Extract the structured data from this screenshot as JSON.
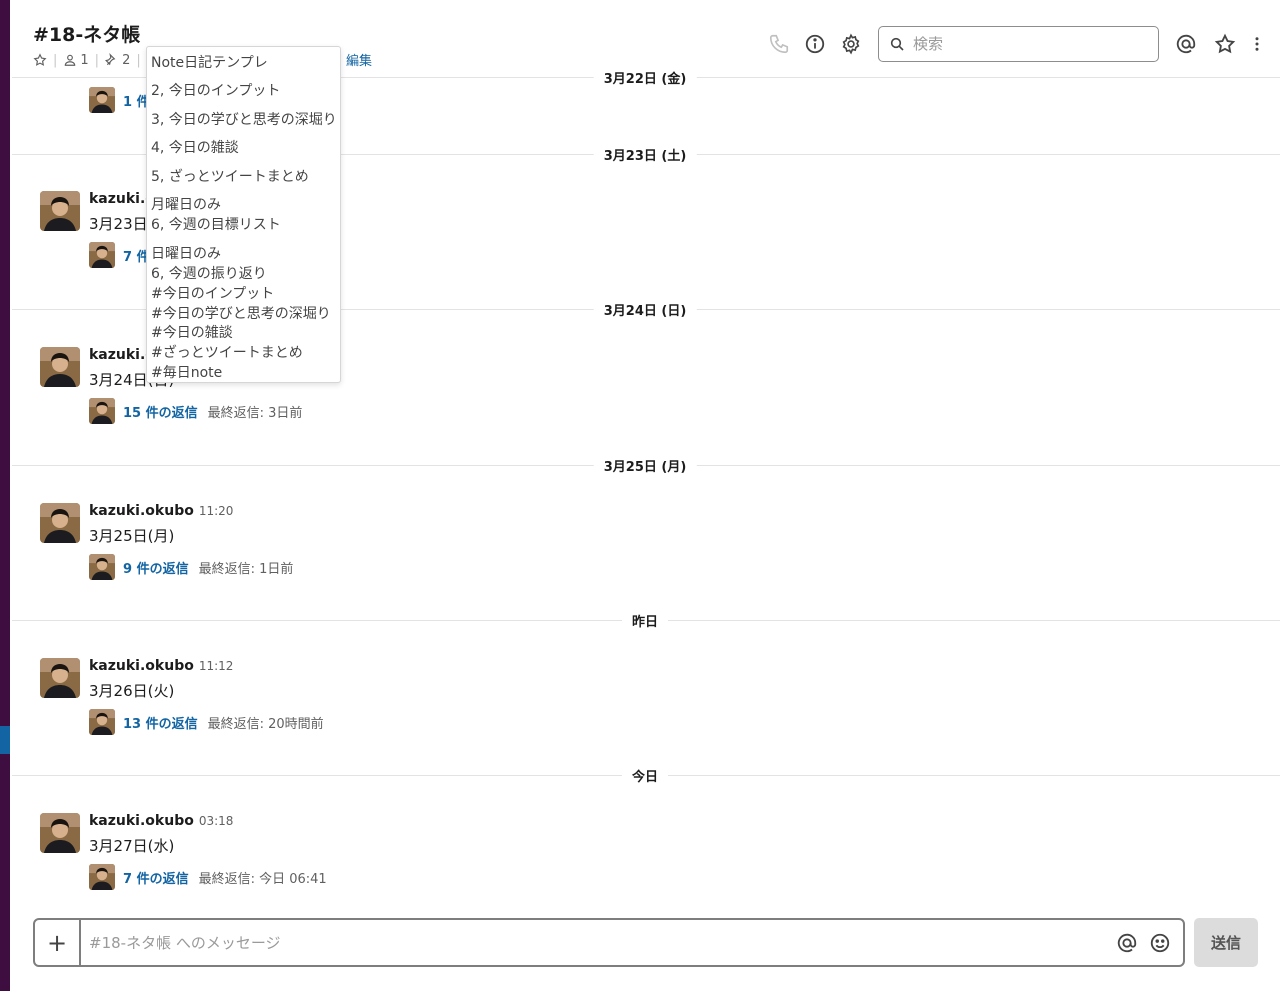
{
  "channel": {
    "title": "#18-ネタ帳",
    "members_count": "1",
    "pins_count": "2",
    "edit_label": "編集"
  },
  "search": {
    "placeholder": "検索"
  },
  "dropdown": {
    "items": [
      "Note日記テンプレ",
      "2, 今日のインプット",
      "3, 今日の学びと思考の深堀り",
      "4, 今日の雑談",
      "5, ざっとツイートまとめ",
      "月曜日のみ",
      "6, 今週の目標リスト",
      "日曜日のみ",
      "6, 今週の振り返り",
      "#今日のインプット",
      "#今日の学びと思考の深堀り",
      "#今日の雑談",
      "#ざっとツイートまとめ",
      "#毎日note"
    ]
  },
  "days": [
    {
      "label": "3月22日 (金)"
    },
    {
      "label": "3月23日 (土)"
    },
    {
      "label": "3月24日 (日)"
    },
    {
      "label": "3月25日 (月)"
    },
    {
      "label": "昨日"
    },
    {
      "label": "今日"
    }
  ],
  "messages": [
    {
      "author": "",
      "time": "",
      "text": "",
      "replies": "1 件",
      "last_reply": ""
    },
    {
      "author": "kazuki.o",
      "time": "",
      "text": "3月23日",
      "replies": "7 件",
      "last_reply": ""
    },
    {
      "author": "kazuki.o",
      "time": "",
      "text": "3月24日(日)",
      "replies": "15 件の返信",
      "last_reply": "最終返信: 3日前"
    },
    {
      "author": "kazuki.okubo",
      "time": "11:20",
      "text": "3月25日(月)",
      "replies": "9 件の返信",
      "last_reply": "最終返信: 1日前"
    },
    {
      "author": "kazuki.okubo",
      "time": "11:12",
      "text": "3月26日(火)",
      "replies": "13 件の返信",
      "last_reply": "最終返信: 20時間前"
    },
    {
      "author": "kazuki.okubo",
      "time": "03:18",
      "text": "3月27日(水)",
      "replies": "7 件の返信",
      "last_reply": "最終返信: 今日 06:41"
    }
  ],
  "composer": {
    "placeholder": "#18-ネタ帳 へのメッセージ",
    "send_label": "送信"
  },
  "colors": {
    "link": "#1264a3",
    "sidebar": "#3f0e40",
    "sidebar_accent": "#1264a3"
  },
  "icons": [
    "star-icon",
    "member-icon",
    "pin-icon",
    "phone-icon",
    "info-icon",
    "gear-icon",
    "search-icon",
    "mention-icon",
    "star-icon",
    "more-icon",
    "plus-icon",
    "emoji-icon"
  ]
}
